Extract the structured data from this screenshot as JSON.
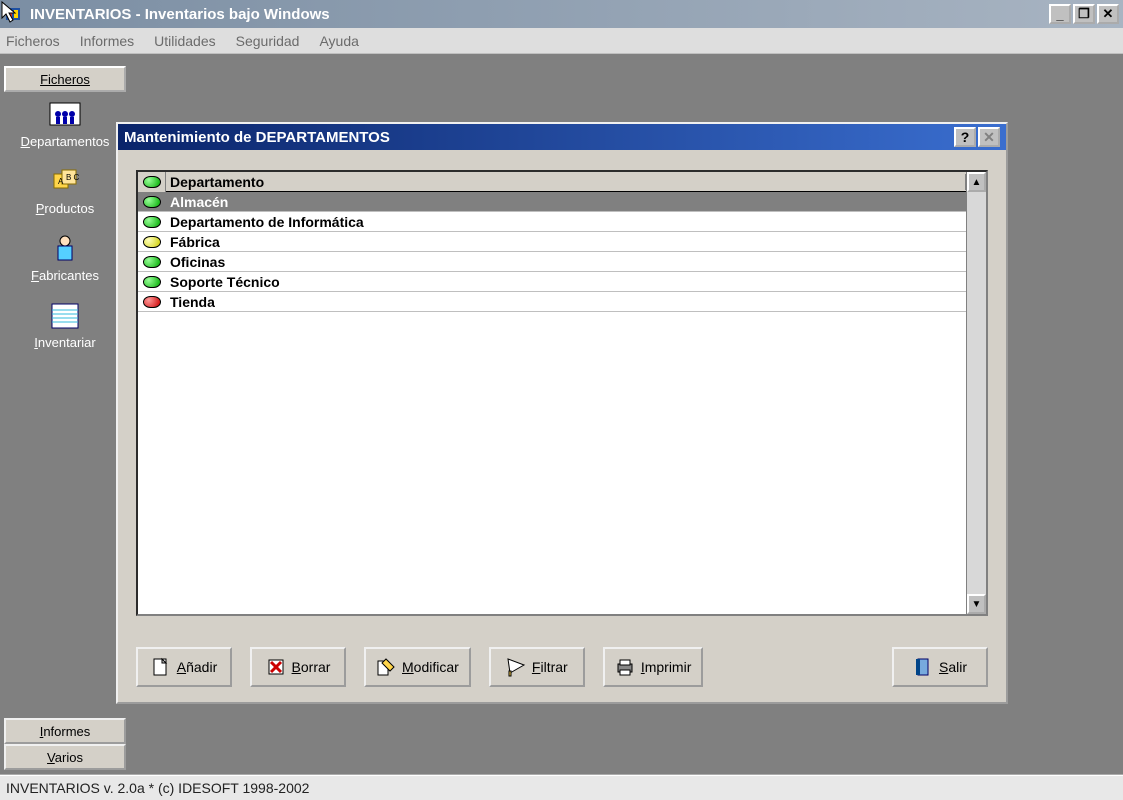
{
  "window": {
    "title": "INVENTARIOS - Inventarios bajo Windows"
  },
  "menubar": {
    "ficheros": "Ficheros",
    "informes": "Informes",
    "utilidades": "Utilidades",
    "seguridad": "Seguridad",
    "ayuda": "Ayuda"
  },
  "tabs": {
    "ficheros": "Ficheros",
    "informes": "Informes",
    "varios": "Varios"
  },
  "sidebar": {
    "items": [
      {
        "label": "Departamentos",
        "u": "D",
        "rest": "epartamentos"
      },
      {
        "label": "Productos",
        "u": "P",
        "rest": "roductos"
      },
      {
        "label": "Fabricantes",
        "u": "F",
        "rest": "abricantes"
      },
      {
        "label": "Inventariar",
        "u": "I",
        "rest": "nventariar"
      }
    ]
  },
  "dialog": {
    "title": "Mantenimiento de DEPARTAMENTOS",
    "header": "Departamento",
    "rows": [
      {
        "label": "Almacén",
        "color": "green",
        "selected": true
      },
      {
        "label": "Departamento de Informática",
        "color": "green",
        "selected": false
      },
      {
        "label": "Fábrica",
        "color": "yellow",
        "selected": false
      },
      {
        "label": "Oficinas",
        "color": "green",
        "selected": false
      },
      {
        "label": "Soporte Técnico",
        "color": "green",
        "selected": false
      },
      {
        "label": "Tienda",
        "color": "red",
        "selected": false
      }
    ],
    "buttons": {
      "anadir": {
        "u": "A",
        "rest": "ñadir"
      },
      "borrar": {
        "u": "B",
        "rest": "orrar"
      },
      "modificar": {
        "u": "M",
        "rest": "odificar"
      },
      "filtrar": {
        "u": "F",
        "rest": "iltrar"
      },
      "imprimir": {
        "u": "I",
        "rest": "mprimir"
      },
      "salir": {
        "u": "S",
        "rest": "alir"
      }
    }
  },
  "statusbar": {
    "text": "INVENTARIOS v. 2.0a * (c) IDESOFT 1998-2002"
  }
}
